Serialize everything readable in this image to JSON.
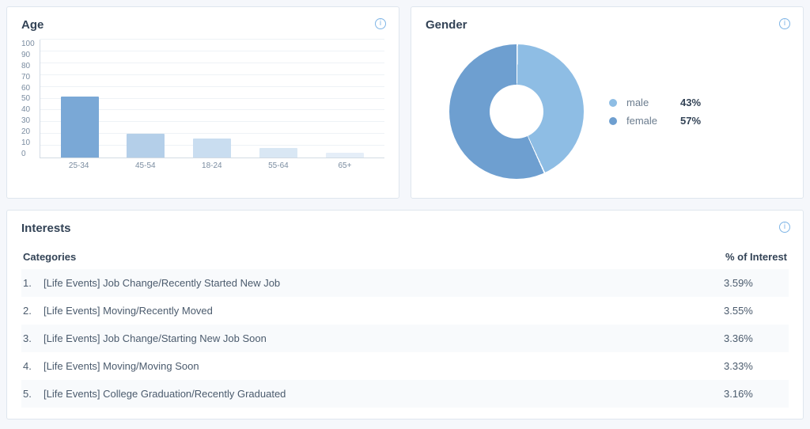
{
  "age": {
    "title": "Age",
    "yticks": [
      "0",
      "10",
      "20",
      "30",
      "40",
      "50",
      "60",
      "70",
      "80",
      "90",
      "100"
    ]
  },
  "gender": {
    "title": "Gender"
  },
  "interests": {
    "title": "Interests",
    "col_categories": "Categories",
    "col_pct": "% of Interest",
    "rows": [
      {
        "idx": "1.",
        "category": "[Life Events] Job Change/Recently Started New Job",
        "pct": "3.59%"
      },
      {
        "idx": "2.",
        "category": "[Life Events] Moving/Recently Moved",
        "pct": "3.55%"
      },
      {
        "idx": "3.",
        "category": "[Life Events] Job Change/Starting New Job Soon",
        "pct": "3.36%"
      },
      {
        "idx": "4.",
        "category": "[Life Events] Moving/Moving Soon",
        "pct": "3.33%"
      },
      {
        "idx": "5.",
        "category": "[Life Events] College Graduation/Recently Graduated",
        "pct": "3.16%"
      }
    ]
  },
  "chart_data": [
    {
      "type": "bar",
      "title": "Age",
      "categories": [
        "25-34",
        "45-54",
        "18-24",
        "55-64",
        "65+"
      ],
      "values": [
        52,
        20,
        16,
        8,
        4
      ],
      "colors": [
        "#7aa8d6",
        "#b4cfe9",
        "#c9ddf0",
        "#d9e7f4",
        "#e5eef8"
      ],
      "ylim": [
        0,
        100
      ]
    },
    {
      "type": "pie",
      "title": "Gender",
      "series": [
        {
          "name": "male",
          "value": 43,
          "label": "43%",
          "color": "#8ebde4"
        },
        {
          "name": "female",
          "value": 57,
          "label": "57%",
          "color": "#6e9fd0"
        }
      ]
    }
  ]
}
